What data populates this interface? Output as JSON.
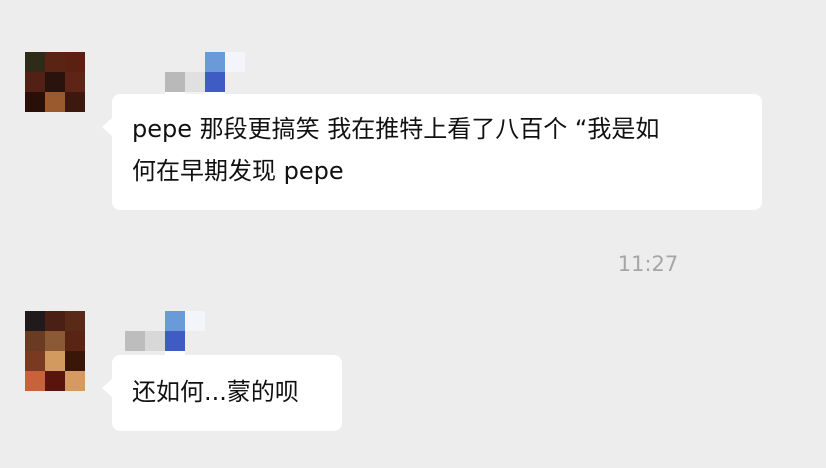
{
  "conversation": {
    "messages": [
      {
        "text_line1": "pepe 那段更搞笑 我在推特上看了八百个 “我是如",
        "text_line2": "何在早期发现 pepe"
      },
      {
        "text_line1": "还如何...蒙的呗"
      }
    ],
    "timestamp": "11:27"
  },
  "colors": {
    "background": "#ededed",
    "bubble": "#ffffff",
    "text": "#111111",
    "timestamp": "#a6a6a6",
    "avatar1": [
      "#2e2b18",
      "#5a2414",
      "#5c2012",
      "#522015",
      "#2a130c",
      "#5e2416",
      "#2a0f08",
      "#9a5a2e",
      "#3d180e"
    ],
    "avatar2": [
      "#211a1a",
      "#4a2014",
      "#5a2a18",
      "#6a3a22",
      "#8a5a36",
      "#5a2414",
      "#7a3a22",
      "#d29a5e",
      "#3a1608",
      "#c8623a",
      "#5a140e",
      "#d49a62"
    ],
    "name_pixels": [
      "#ffffff",
      "#b9b9b9",
      "#f4f4f4",
      "#6a9ad8",
      "#3f5bc4",
      "#ffffff",
      "#ededed",
      "#ededed",
      "#f0f4fb"
    ]
  }
}
